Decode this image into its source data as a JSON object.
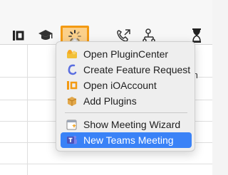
{
  "menu": {
    "items": [
      {
        "label": "Open PluginCenter",
        "icon": "plugin-center-icon"
      },
      {
        "label": "Create Feature Request",
        "icon": "feature-request-icon"
      },
      {
        "label": "Open iOAccount",
        "icon": "ioaccount-icon"
      },
      {
        "label": "Add Plugins",
        "icon": "add-plugins-icon"
      },
      {
        "label": "Show Meeting Wizard",
        "icon": "meeting-wizard-icon"
      },
      {
        "label": "New Teams Meeting",
        "icon": "teams-icon",
        "selected": true
      }
    ]
  },
  "background": {
    "partial_text": "th"
  },
  "colors": {
    "selection": "#3a82f7",
    "active_button_fill": "#fbd08a",
    "active_button_border": "#f39a12"
  }
}
